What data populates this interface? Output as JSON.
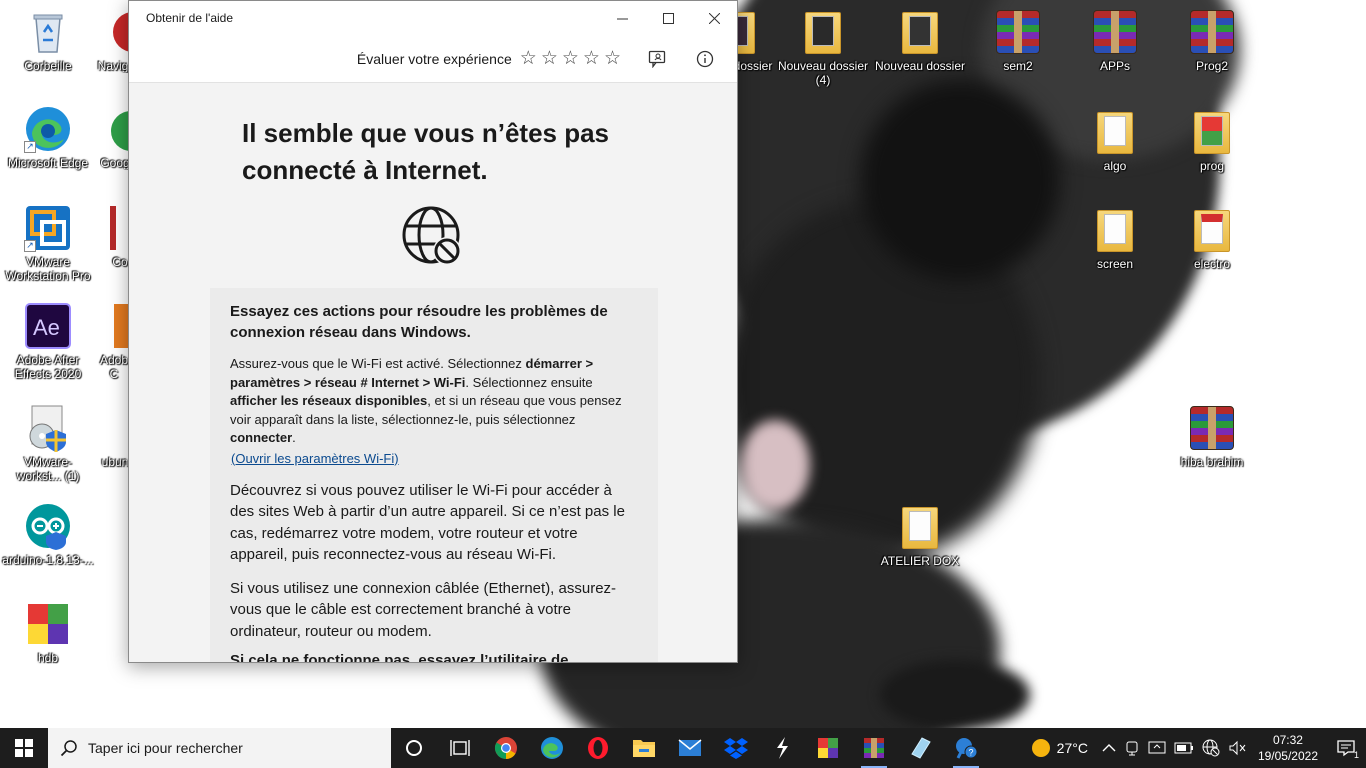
{
  "help_window": {
    "title": "Obtenir de l'aide",
    "rate_label": "Évaluer votre expérience",
    "stars": [
      "☆",
      "☆",
      "☆",
      "☆",
      "☆"
    ],
    "headline": "Il semble que vous n’êtes pas connecté à Internet.",
    "card_title": "Essayez ces actions pour résoudre les problèmes de connexion réseau dans Windows.",
    "instructions": {
      "t1": "Assurez-vous que le Wi-Fi est activé. Sélectionnez ",
      "b1": "démarrer > paramètres > réseau # Internet > Wi-Fi",
      "t2": ". Sélectionnez ensuite ",
      "b2": "afficher les réseaux disponibles",
      "t3": ", et si un réseau que vous pensez voir apparaît dans la liste, sélectionnez-le, puis sélectionnez ",
      "b3": "connecter",
      "t4": "."
    },
    "wifi_link": "(Ouvrir les paramètres Wi-Fi)",
    "para_wifi": "Découvrez si vous pouvez utiliser le Wi-Fi pour accéder à des sites Web à partir d’un autre appareil. Si ce n’est pas le cas, redémarrez votre modem, votre routeur et votre appareil, puis reconnectez-vous au réseau Wi-Fi.",
    "para_cable": "Si vous utilisez une connexion câblée (Ethernet), assurez-vous que le câble est correctement branché à votre ordinateur, routeur ou modem.",
    "para_cut": "Si cela ne fonctionne pas, essayez l’utilitaire de"
  },
  "desktop_icons": [
    {
      "label": "Corbeille",
      "icon": "recycle-bin-icon"
    },
    {
      "label": "Navig",
      "icon": "browser-icon"
    },
    {
      "label": "Microsoft Edge",
      "icon": "edge-icon"
    },
    {
      "label": "Goog",
      "icon": "chrome-icon"
    },
    {
      "label": "VMware Workstation Pro",
      "icon": "vmware-icon"
    },
    {
      "label": "Co",
      "icon": "app-icon"
    },
    {
      "label": "Adobe After Effects 2020",
      "icon": "after-effects-icon"
    },
    {
      "label": "Adob C",
      "icon": "adobe-icon"
    },
    {
      "label": "VMware-workst... (1)",
      "icon": "installer-icon"
    },
    {
      "label": "ubun",
      "icon": "app-icon"
    },
    {
      "label": "arduino-1.8.13-...",
      "icon": "arduino-icon"
    },
    {
      "label": "hdb",
      "icon": "winrar-icon"
    },
    {
      "label": "dossier",
      "icon": "folder-icon"
    },
    {
      "label": "Nouveau dossier (4)",
      "icon": "folder-icon"
    },
    {
      "label": "Nouveau dossier",
      "icon": "folder-icon"
    },
    {
      "label": "sem2",
      "icon": "winrar-icon"
    },
    {
      "label": "APPs",
      "icon": "winrar-icon"
    },
    {
      "label": "Prog2",
      "icon": "winrar-icon"
    },
    {
      "label": "algo",
      "icon": "folder-icon"
    },
    {
      "label": "prog",
      "icon": "folder-icon"
    },
    {
      "label": "screen",
      "icon": "folder-icon"
    },
    {
      "label": "electro",
      "icon": "folder-icon"
    },
    {
      "label": "hiba brahim",
      "icon": "winrar-icon"
    },
    {
      "label": "ATELIER DOX",
      "icon": "folder-icon"
    }
  ],
  "taskbar": {
    "search_placeholder": "Taper ici pour rechercher",
    "weather_temp": "27°C",
    "time": "07:32",
    "date": "19/05/2022",
    "notification_count": "1"
  }
}
